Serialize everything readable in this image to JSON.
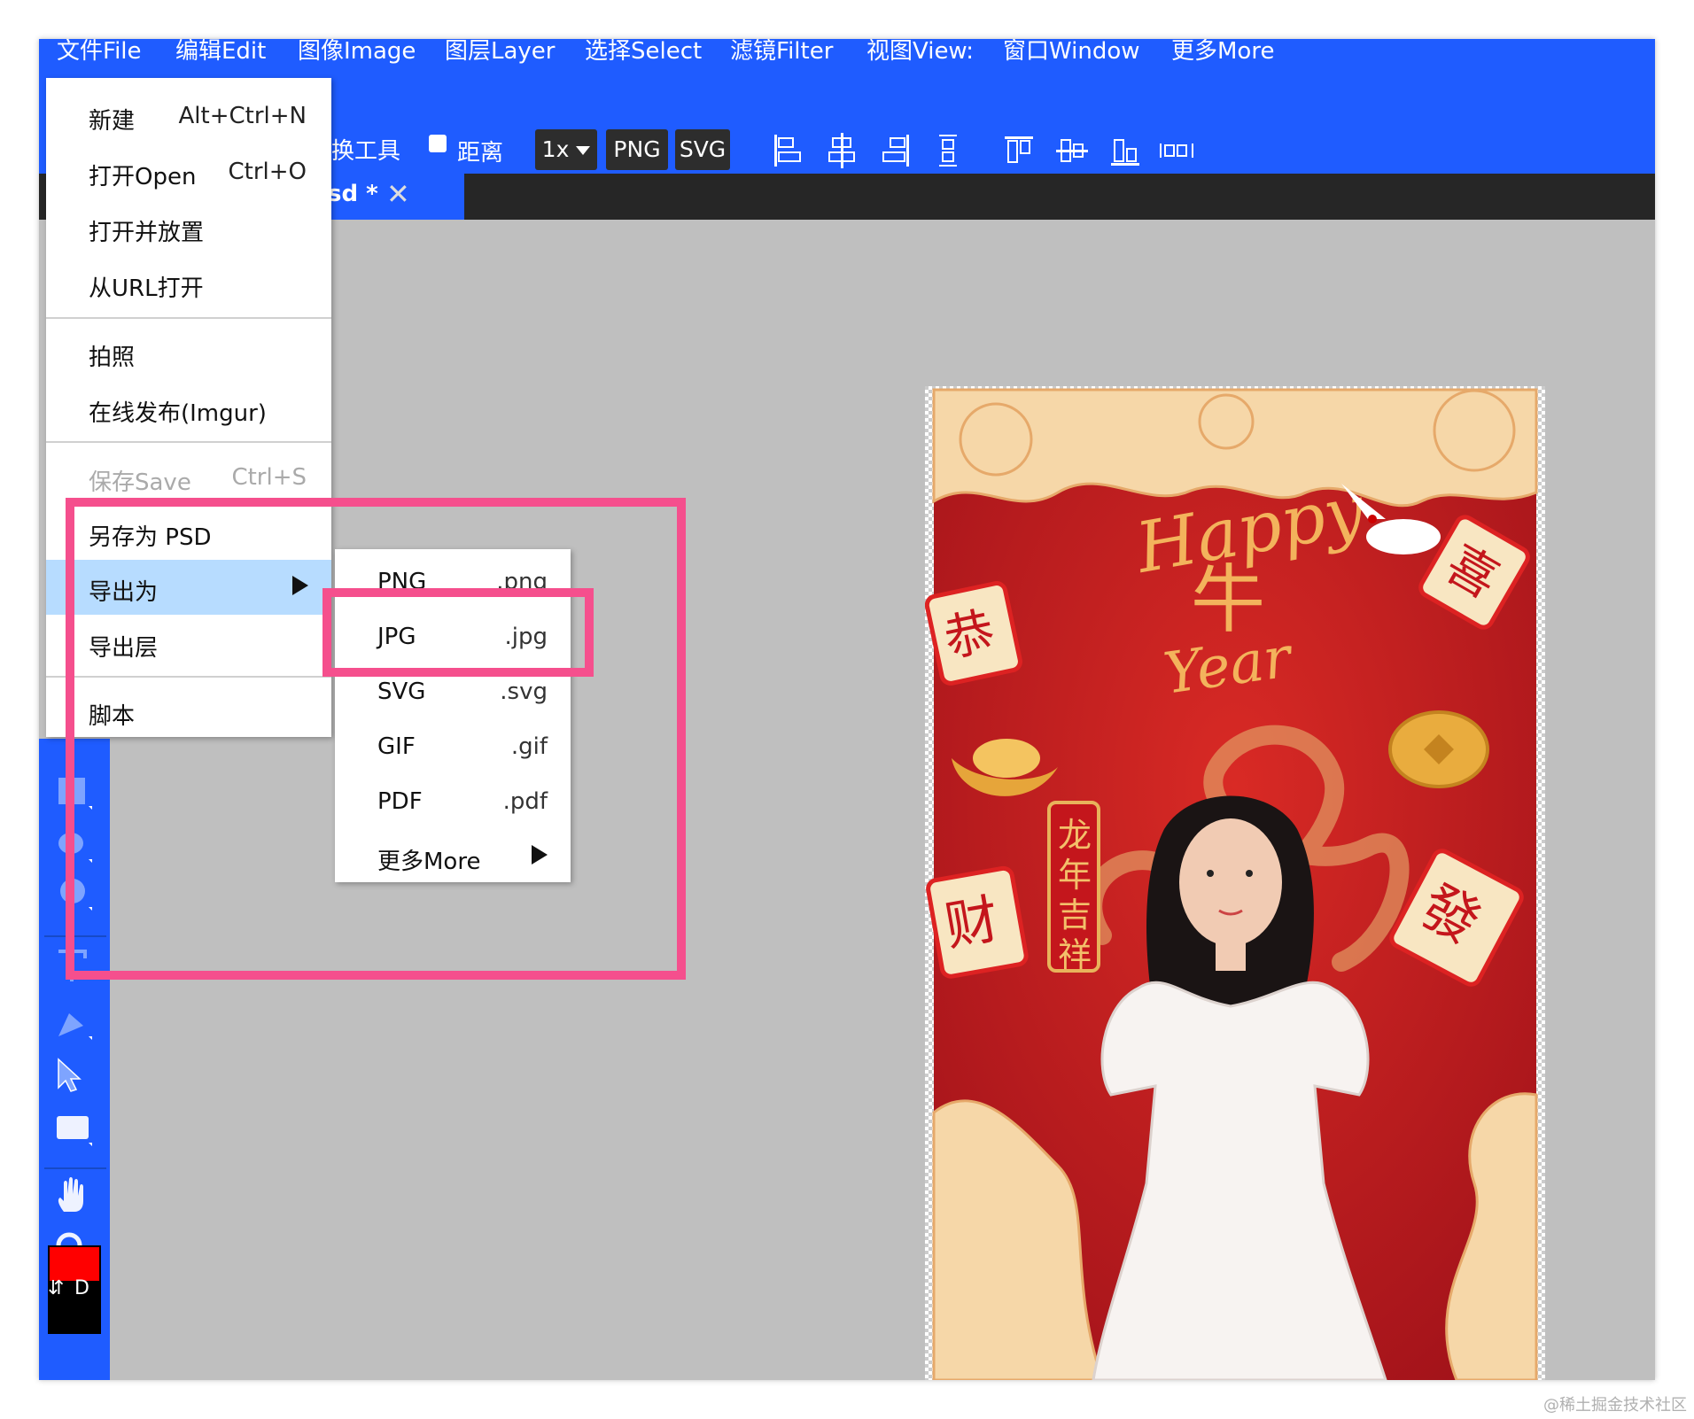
{
  "menubar": {
    "items": [
      "文件File",
      "编辑Edit",
      "图像Image",
      "图层Layer",
      "选择Select",
      "滤镜Filter",
      "视图View:",
      "窗口Window",
      "更多More"
    ]
  },
  "toolbar": {
    "transform_label": "换工具",
    "distance_label": "距离",
    "zoom_label": "1x",
    "png_label": "PNG",
    "svg_label": "SVG"
  },
  "tab": {
    "title": "sd *",
    "close": "✕"
  },
  "file_menu": {
    "items": [
      {
        "label": "新建",
        "shortcut": "Alt+Ctrl+N"
      },
      {
        "label": "打开Open",
        "shortcut": "Ctrl+O"
      },
      {
        "label": "打开并放置",
        "shortcut": ""
      },
      {
        "label": "从URL打开",
        "shortcut": ""
      },
      {
        "label": "拍照",
        "shortcut": ""
      },
      {
        "label": "在线发布(Imgur)",
        "shortcut": ""
      },
      {
        "label": "保存Save",
        "shortcut": "Ctrl+S"
      },
      {
        "label": "另存为 PSD",
        "shortcut": ""
      },
      {
        "label": "导出为",
        "shortcut": ""
      },
      {
        "label": "导出层",
        "shortcut": ""
      },
      {
        "label": "脚本",
        "shortcut": ""
      }
    ]
  },
  "export_submenu": {
    "items": [
      {
        "label": "PNG",
        "ext": ".png"
      },
      {
        "label": "JPG",
        "ext": ".jpg"
      },
      {
        "label": "SVG",
        "ext": ".svg"
      },
      {
        "label": "GIF",
        "ext": ".gif"
      },
      {
        "label": "PDF",
        "ext": ".pdf"
      },
      {
        "label": "更多More",
        "ext": ""
      }
    ]
  },
  "tools": {
    "swap_label": "⇵",
    "default_label": "D"
  },
  "colors": {
    "accent": "#1f5cff",
    "highlight": "#f54f8d",
    "foreground": "#ff0000",
    "background": "#000000"
  },
  "poster": {
    "text_happy": "Happy",
    "text_year": "Year",
    "text_niu": "牛",
    "banner": [
      "龙",
      "年",
      "吉",
      "祥"
    ],
    "tiles": [
      "恭",
      "喜",
      "财",
      "發"
    ]
  },
  "watermark": "@稀土掘金技术社区"
}
